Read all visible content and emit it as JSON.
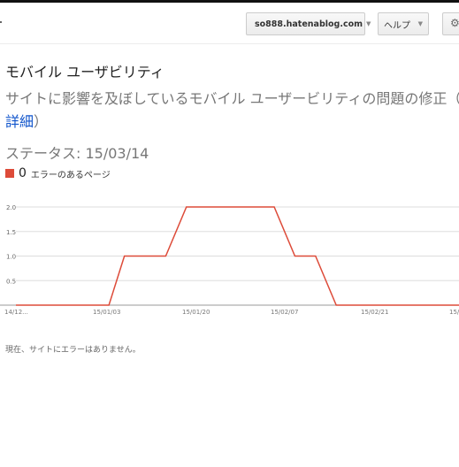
{
  "header": {
    "account_label": "so888.hatenablog.com",
    "help_label": "ヘルプ",
    "settings_icon": "gear-icon"
  },
  "page": {
    "title": "モバイル ユーザビリティ",
    "subtitle_line1": "サイトに影響を及ぼしているモバイル ユーザービリティの問題の修正（",
    "subtitle_link": "詳細",
    "subtitle_close": "）",
    "status": "ステータス: 15/03/14",
    "legend_count": "0",
    "legend_label": "エラーのあるページ",
    "footer_text": "現在、サイトにエラーはありません。"
  },
  "colors": {
    "series": "#dd4b39",
    "link": "#1155cc"
  },
  "chart_data": {
    "type": "line",
    "x_tick_labels": [
      "14/12...",
      "15/01/03",
      "15/01/20",
      "15/02/07",
      "15/02/21",
      "15/0..."
    ],
    "y_tick_labels": [
      "2.0",
      "1.5",
      "1.0",
      "0.5"
    ],
    "ylim": [
      0,
      2
    ],
    "grid": true,
    "series": [
      {
        "name": "エラーのあるページ",
        "color": "#dd4b39",
        "x": [
          "14/12/22",
          "15/01/09",
          "15/01/12",
          "15/01/20",
          "15/01/24",
          "15/02/10",
          "15/02/14",
          "15/02/18",
          "15/02/22",
          "15/03/14"
        ],
        "values": [
          0,
          0,
          1,
          1,
          2,
          2,
          1,
          1,
          0,
          0
        ]
      }
    ]
  }
}
